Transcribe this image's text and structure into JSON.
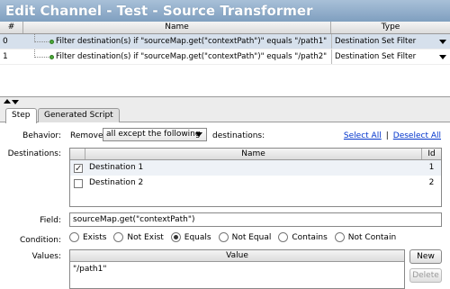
{
  "window": {
    "title": "Edit Channel - Test - Source Transformer"
  },
  "rules_table": {
    "columns": [
      "#",
      "Name",
      "Type"
    ],
    "rows": [
      {
        "num": "0",
        "name": "Filter destination(s) if \"sourceMap.get(\"contextPath\")\" equals \"/path1\"",
        "type": "Destination Set Filter"
      },
      {
        "num": "1",
        "name": "Filter destination(s) if \"sourceMap.get(\"contextPath\")\" equals \"/path2\"",
        "type": "Destination Set Filter"
      }
    ]
  },
  "tabs": [
    {
      "label": "Step"
    },
    {
      "label": "Generated Script"
    }
  ],
  "step": {
    "behavior_label": "Behavior:",
    "remove_text": "Remove",
    "behavior_value": "all except the following",
    "destinations_text": "destinations:",
    "select_all": "Select All",
    "link_sep": "|",
    "deselect_all": "Deselect All",
    "destinations_label": "Destinations:",
    "dest_columns": [
      "",
      "Name",
      "Id"
    ],
    "destinations": [
      {
        "checked": true,
        "name": "Destination 1",
        "id": "1"
      },
      {
        "checked": false,
        "name": "Destination 2",
        "id": "2"
      }
    ],
    "field_label": "Field:",
    "field_value": "sourceMap.get(\"contextPath\")",
    "condition_label": "Condition:",
    "conditions": [
      "Exists",
      "Not Exist",
      "Equals",
      "Not Equal",
      "Contains",
      "Not Contain"
    ],
    "selected_condition": "Equals",
    "values_label": "Values:",
    "values_header": "Value",
    "values": [
      "\"/path1\""
    ],
    "new_button": "New",
    "delete_button": "Delete"
  }
}
